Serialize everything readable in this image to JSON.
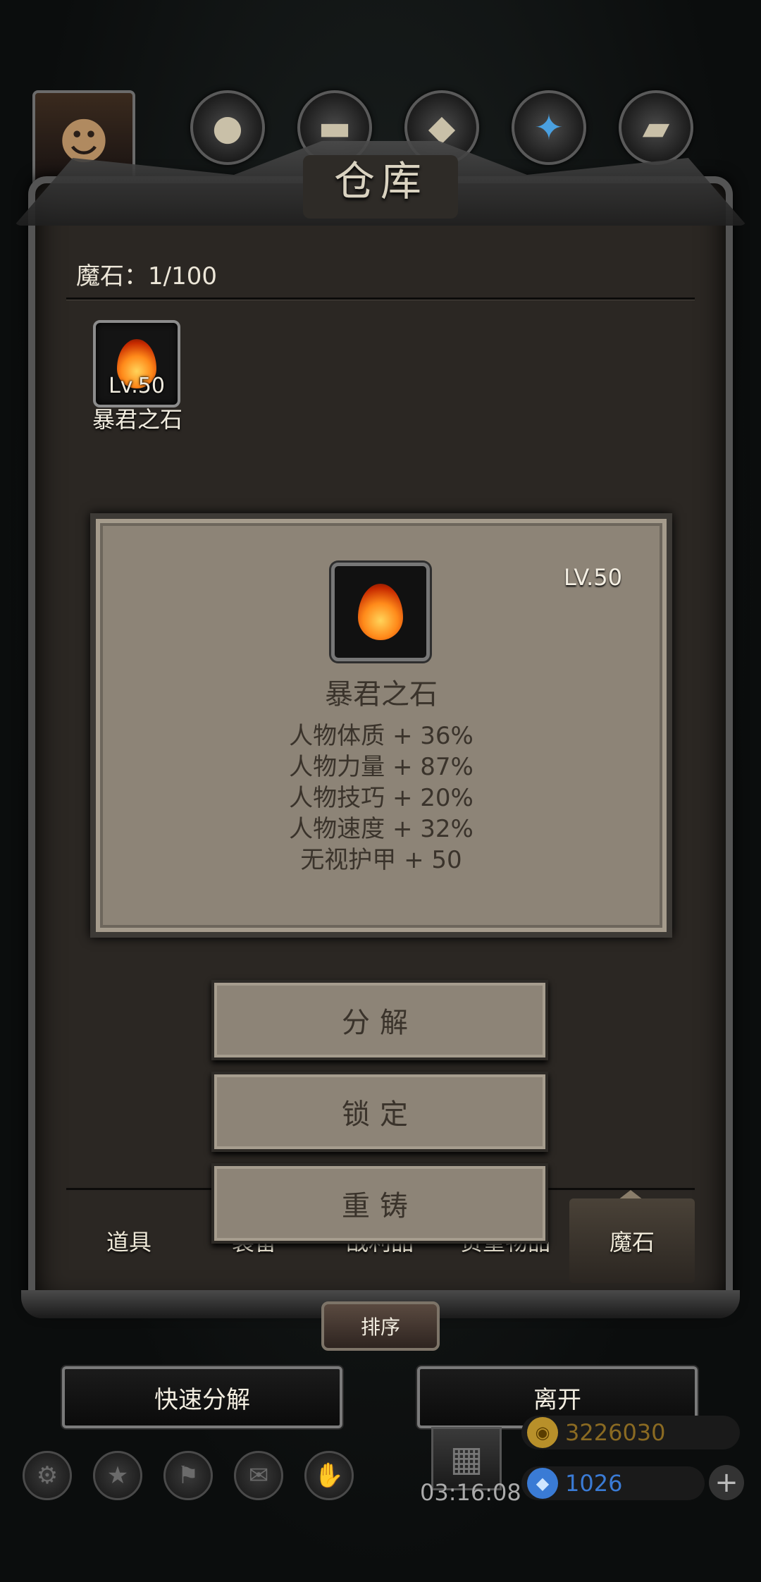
{
  "panel": {
    "title": "仓库",
    "count_label": "魔石：1/100"
  },
  "top_icons": [
    "avatar-icon",
    "orb-icon",
    "wood-icon",
    "ore-icon",
    "crystal-icon",
    "iron-icon"
  ],
  "slot": {
    "level": "Lv.50",
    "name": "暴君之石"
  },
  "detail": {
    "level": "LV.50",
    "name": "暴君之石",
    "stats": [
      "人物体质 + 36%",
      "人物力量 + 87%",
      "人物技巧 + 20%",
      "人物速度 + 32%",
      "无视护甲 + 50"
    ]
  },
  "actions": {
    "decompose": "分解",
    "lock": "锁定",
    "reforge": "重铸"
  },
  "tabs": [
    {
      "label": "道具",
      "active": false
    },
    {
      "label": "装备",
      "active": false
    },
    {
      "label": "战利品",
      "active": false
    },
    {
      "label": "贵重物品",
      "active": false
    },
    {
      "label": "魔石",
      "active": true
    }
  ],
  "sort_label": "排序",
  "buttons": {
    "quick_decompose": "快速分解",
    "leave": "离开"
  },
  "hud": {
    "timer": "03:16:08",
    "gold": "3226030",
    "gems": "1026"
  },
  "colors": {
    "card_bg": "#8d8477",
    "panel_bg": "#2b2723",
    "gold": "#b8902a",
    "gem": "#3a7bd5"
  }
}
